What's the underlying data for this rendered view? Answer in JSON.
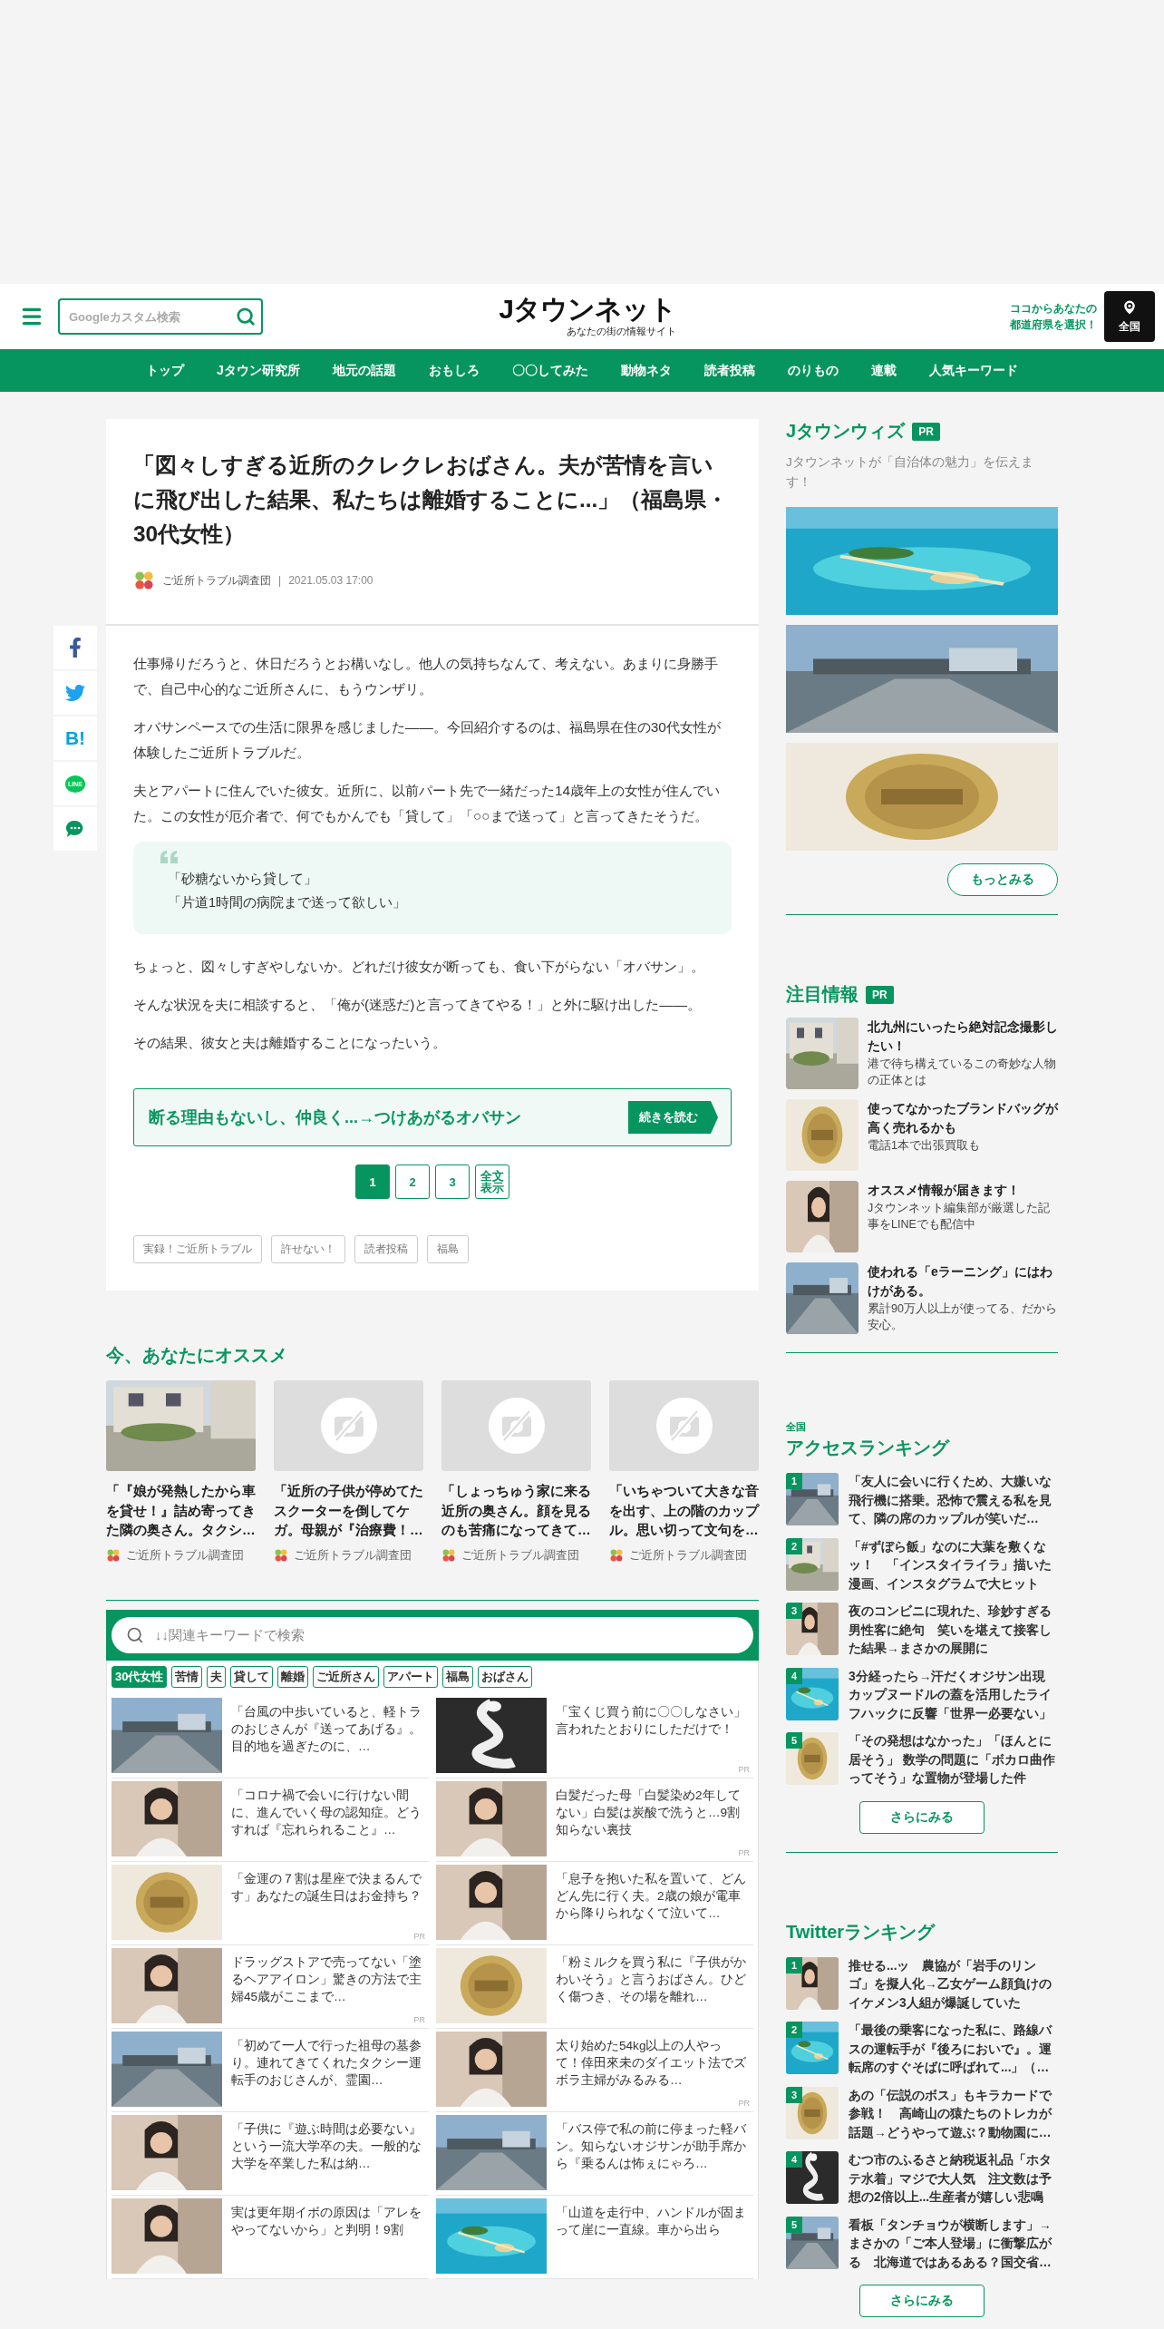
{
  "header": {
    "search_placeholder": "Googleカスタム検索",
    "logo": "Jタウンネット",
    "tagline": "あなたの街の情報サイト",
    "region_prompt": "ココからあなたの都道府県を選択！",
    "region_button": "全国"
  },
  "nav": [
    "トップ",
    "Jタウン研究所",
    "地元の話題",
    "おもしろ",
    "〇〇してみた",
    "動物ネタ",
    "読者投稿",
    "のりもの",
    "連載",
    "人気キーワード"
  ],
  "share_buttons": [
    {
      "kind": "facebook"
    },
    {
      "kind": "twitter"
    },
    {
      "kind": "hatena",
      "label": "B!"
    },
    {
      "kind": "line",
      "label": "LINE"
    },
    {
      "kind": "comment"
    }
  ],
  "article": {
    "title": "「図々しすぎる近所のクレクレおばさん。夫が苦情を言いに飛び出した結果、私たちは離婚することに...」（福島県・30代女性）",
    "author": "ご近所トラブル調査団",
    "separator": "|",
    "date": "2021.05.03 17:00",
    "paragraphs_before": [
      "仕事帰りだろうと、休日だろうとお構いなし。他人の気持ちなんて、考えない。あまりに身勝手で、自己中心的なご近所さんに、もうウンザリ。",
      "オバサンペースでの生活に限界を感じました――。今回紹介するのは、福島県在住の30代女性が体験したご近所トラブルだ。",
      "夫とアパートに住んでいた彼女。近所に、以前パート先で一緒だった14歳年上の女性が住んでいた。この女性が厄介者で、何でもかんでも「貸して」「○○まで送って」と言ってきたそうだ。"
    ],
    "quote": [
      "「砂糖ないから貸して」",
      "「片道1時間の病院まで送って欲しい」"
    ],
    "paragraphs_after": [
      "ちょっと、図々しすぎやしないか。どれだけ彼女が断っても、食い下がらない「オバサン」。",
      "そんな状況を夫に相談すると、「俺が(迷惑だ)と言ってきてやる！」と外に駆け出した――。",
      "その結果、彼女と夫は離婚することになったいう。"
    ],
    "next_page": {
      "teaser": "断る理由もないし、仲良く...→つけあがるオバサン",
      "button": "続きを読む"
    },
    "pagination": [
      {
        "label": "1",
        "selected": true
      },
      {
        "label": "2",
        "selected": false
      },
      {
        "label": "3",
        "selected": false
      },
      {
        "label": "全文表示",
        "selected": false
      }
    ],
    "tags": [
      "実録！ご近所トラブル",
      "許せない！",
      "読者投稿",
      "福島"
    ]
  },
  "recommendations": {
    "title": "今、あなたにオススメ",
    "cards": [
      {
        "kind": "picture",
        "title": "「『娘が発熱したから車を貸せ！』詰め寄ってきた隣の奥さん。タクシ…",
        "author": "ご近所トラブル調査団"
      },
      {
        "kind": "no_image",
        "title": "「近所の子供が停めてたスクーターを倒してケガ。母親が『治療費！…",
        "author": "ご近所トラブル調査団"
      },
      {
        "kind": "no_image",
        "title": "「しょっちゅう家に来る近所の奥さん。顔を見るのも苦痛になってきて…",
        "author": "ご近所トラブル調査団"
      },
      {
        "kind": "no_image",
        "title": "「いちゃついて大きな音を出す、上の階のカップル。思い切って文句を…",
        "author": "ご近所トラブル調査団"
      }
    ]
  },
  "keyword_search": {
    "placeholder": "↓↓関連キーワードで検索",
    "tags": [
      {
        "label": "30代女性",
        "selected": true
      },
      {
        "label": "苦情",
        "selected": false
      },
      {
        "label": "夫",
        "selected": false
      },
      {
        "label": "貸して",
        "selected": false
      },
      {
        "label": "離婚",
        "selected": false
      },
      {
        "label": "ご近所さん",
        "selected": false
      },
      {
        "label": "アパート",
        "selected": false
      },
      {
        "label": "福島",
        "selected": false
      },
      {
        "label": "おばさん",
        "selected": false
      }
    ],
    "items": [
      {
        "text": "「台風の中歩いていると、軽トラのおじさんが『送ってあげる』。目的地を過ぎたのに、…"
      },
      {
        "text": "「宝くじ買う前に〇〇しなさい」言われたとおりにしただけで！",
        "pr_label": "PR"
      },
      {
        "text": "「コロナ禍で会いに行けない間に、進んでいく母の認知症。どうすれば『忘れられること』…"
      },
      {
        "text": "白髪だった母「白髪染め2年してない」白髪は炭酸で洗うと…9割知らない裏技",
        "pr_label": "PR"
      },
      {
        "text": "「金運の７割は星座で決まるんです」あなたの誕生日はお金持ち？",
        "pr_label": "PR"
      },
      {
        "text": "「息子を抱いた私を置いて、どんどん先に行く夫。2歳の娘が電車から降りられなくて泣いて…"
      },
      {
        "text": "ドラッグストアで売ってない「塗るヘアアイロン」驚きの方法で主婦45歳がここまで…",
        "pr_label": "PR"
      },
      {
        "text": "「粉ミルクを買う私に『子供がかわいそう』と言うおばさん。ひどく傷つき、その場を離れ…"
      },
      {
        "text": "「初めて一人で行った祖母の墓参り。連れてきてくれたタクシー運転手のおじさんが、霊園…"
      },
      {
        "text": "太り始めた54kg以上の人やって！倖田來未のダイエット法でズボラ主婦がみるみる…",
        "pr_label": "PR"
      },
      {
        "text": "「子供に『遊ぶ時間は必要ない』という一流大学卒の夫。一般的な大学を卒業した私は納…"
      },
      {
        "text": "「バス停で私の前に停まった軽バン。知らないオジサンが助手席から『乗るんは怖ぇにゃろ…"
      },
      {
        "text": "実は更年期イボの原因は「アレをやってないから」と判明！9割"
      },
      {
        "text": "「山道を走行中、ハンドルが固まって崖に一直線。車から出ら"
      }
    ]
  },
  "sidebar": {
    "wiz": {
      "title": "Jタウンウィズ",
      "badge": "PR",
      "description": "Jタウンネットが「自治体の魅力」を伝えます！",
      "more": "もっとみる"
    },
    "featured": {
      "title": "注目情報",
      "badge": "PR",
      "items": [
        {
          "title": "北九州にいったら絶対記念撮影したい！",
          "description": "港で待ち構えているこの奇妙な人物の正体とは"
        },
        {
          "title": "使ってなかったブランドバッグが高く売れるかも",
          "description": "電話1本で出張買取も"
        },
        {
          "title": "オススメ情報が届きます！",
          "description": "Jタウンネット編集部が厳選した記事をLINEでも配信中"
        },
        {
          "title": "使われる「eラーニング」にはわけがある。",
          "description": "累計90万人以上が使ってる、だから安心。"
        }
      ]
    },
    "access_ranking": {
      "scope": "全国",
      "title": "アクセスランキング",
      "more": "さらにみる",
      "items": [
        {
          "rank": "1",
          "text": "「友人に会いに行くため、大嫌いな飛行機に搭乗。恐怖で震える私を見て、隣の席のカップルが笑いだ…"
        },
        {
          "rank": "2",
          "text": "「#ずぼら飯」なのに大葉を敷くなッ！　「インスタイライラ」描いた漫画、インスタグラムで大ヒット"
        },
        {
          "rank": "3",
          "text": "夜のコンビニに現れた、珍妙すぎる男性客に絶句　笑いを堪えて接客した結果→まさかの展開に"
        },
        {
          "rank": "4",
          "text": "3分経ったら→汗だくオジサン出現カップヌードルの蓋を活用したライフハックに反響「世界一必要ない」"
        },
        {
          "rank": "5",
          "text": "「その発想はなかった」「ほんとに居そう」 数学の問題に「ボカロ曲作ってそう」な置物が登場した件"
        }
      ]
    },
    "twitter_ranking": {
      "title": "Twitterランキング",
      "more": "さらにみる",
      "items": [
        {
          "rank": "1",
          "text": "推せる...ッ　農協が「岩手のリンゴ」を擬人化→乙女ゲーム顔負けのイケメン3人組が爆誕していた"
        },
        {
          "rank": "2",
          "text": "「最後の乗客になった私に、路線バスの運転手が『後ろにおいで』。運転席のすぐそばに呼ばれて...」（…"
        },
        {
          "rank": "3",
          "text": "あの「伝説のボス」もキラカードで参戦！　高崎山の猿たちのトレカが話題→どうやって遊ぶ？動物園に…"
        },
        {
          "rank": "4",
          "text": "むつ市のふるさと納税返礼品「ホタテ水着」マジで大人気　注文数は予想の2倍以上...生産者が嬉しい悲鳴"
        },
        {
          "rank": "5",
          "text": "看板「タンチョウが横断します」→まさかの「ご本人登場」に衝撃広がる　北海道ではあるある？国交省…"
        }
      ]
    }
  }
}
